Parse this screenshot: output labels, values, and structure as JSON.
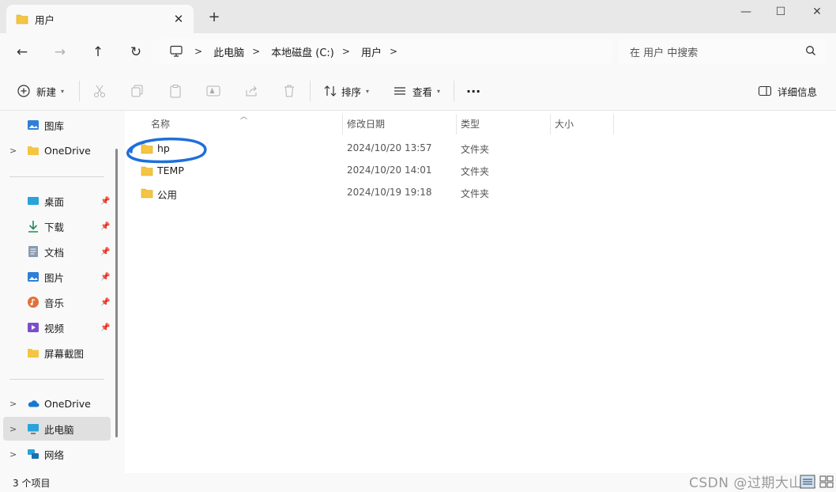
{
  "window": {
    "tab_title": "用户",
    "tab_close": "✕",
    "new_tab": "+",
    "minimize": "—",
    "maximize": "☐",
    "close": "✕"
  },
  "address": {
    "crumbs": [
      "此电脑",
      "本地磁盘 (C:)",
      "用户"
    ],
    "separator": ">"
  },
  "search": {
    "placeholder": "在 用户 中搜索"
  },
  "toolbar": {
    "new_label": "新建",
    "sort_label": "排序",
    "view_label": "查看",
    "more_label": "···",
    "details_label": "详细信息",
    "icons": [
      "cut-icon",
      "copy-icon",
      "paste-icon",
      "rename-icon",
      "share-icon",
      "delete-icon"
    ]
  },
  "sidebar": {
    "items": [
      {
        "label": "图库",
        "icon": "gallery-icon"
      },
      {
        "label": "OneDrive",
        "icon": "folder-icon",
        "expandable": true
      },
      {
        "label": "桌面",
        "icon": "desktop-icon",
        "pinned": true
      },
      {
        "label": "下载",
        "icon": "download-icon",
        "pinned": true
      },
      {
        "label": "文档",
        "icon": "document-icon",
        "pinned": true
      },
      {
        "label": "图片",
        "icon": "pictures-icon",
        "pinned": true
      },
      {
        "label": "音乐",
        "icon": "music-icon",
        "pinned": true
      },
      {
        "label": "视频",
        "icon": "video-icon",
        "pinned": true
      },
      {
        "label": "屏幕截图",
        "icon": "folder-icon"
      },
      {
        "label": "OneDrive",
        "icon": "cloud-icon",
        "expandable": true
      },
      {
        "label": "此电脑",
        "icon": "pc-icon",
        "expandable": true,
        "selected": true
      },
      {
        "label": "网络",
        "icon": "network-icon",
        "expandable": true
      }
    ],
    "chevron": ">",
    "pin": "📌"
  },
  "columns": [
    "名称",
    "修改日期",
    "类型",
    "大小"
  ],
  "files": [
    {
      "name": "hp",
      "date": "2024/10/20 13:57",
      "type": "文件夹",
      "annotated": true
    },
    {
      "name": "TEMP",
      "date": "2024/10/20 14:01",
      "type": "文件夹"
    },
    {
      "name": "公用",
      "date": "2024/10/19 19:18",
      "type": "文件夹"
    }
  ],
  "status": {
    "count": "3 个项目"
  },
  "watermark": "CSDN @过期大山童",
  "colors": {
    "folder": "#f4c542",
    "annotation": "#1e6fd9",
    "selected": "#e0e0e0"
  }
}
